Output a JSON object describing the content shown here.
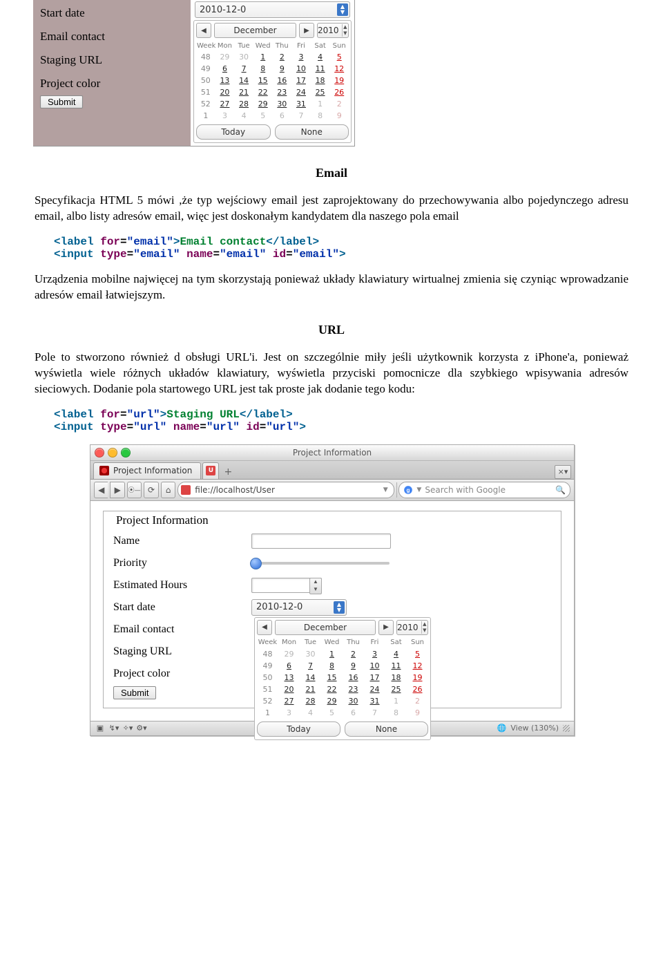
{
  "form": {
    "labels": {
      "start_date": "Start date",
      "email_contact": "Email contact",
      "staging_url": "Staging URL",
      "project_color": "Project color",
      "name": "Name",
      "priority": "Priority",
      "estimated_hours": "Estimated Hours"
    },
    "submit_label": "Submit",
    "date_value": "2010-12-0",
    "legend": "Project Information"
  },
  "calendar": {
    "month": "December",
    "year": "2010",
    "today_label": "Today",
    "none_label": "None",
    "head": [
      "Week",
      "Mon",
      "Tue",
      "Wed",
      "Thu",
      "Fri",
      "Sat",
      "Sun"
    ],
    "rows": [
      {
        "wk": "48",
        "d": [
          29,
          30,
          1,
          2,
          3,
          4,
          5
        ],
        "out": [
          0,
          1
        ],
        "sun": 6
      },
      {
        "wk": "49",
        "d": [
          6,
          7,
          8,
          9,
          10,
          11,
          12
        ],
        "out": [],
        "sun": 6
      },
      {
        "wk": "50",
        "d": [
          13,
          14,
          15,
          16,
          17,
          18,
          19
        ],
        "out": [],
        "sun": 6
      },
      {
        "wk": "51",
        "d": [
          20,
          21,
          22,
          23,
          24,
          25,
          26
        ],
        "out": [],
        "sun": 6
      },
      {
        "wk": "52",
        "d": [
          27,
          28,
          29,
          30,
          31,
          1,
          2
        ],
        "out": [
          5,
          6
        ],
        "sun": 6
      },
      {
        "wk": "1",
        "d": [
          3,
          4,
          5,
          6,
          7,
          8,
          9
        ],
        "out": [
          0,
          1,
          2,
          3,
          4,
          5,
          6
        ],
        "sun": 6
      }
    ]
  },
  "sections": {
    "email_title": "Email",
    "email_p": "Specyfikacja HTML 5 mówi ,że typ wejściowy email jest zaprojektowany do przechowywania albo pojedynczego adresu email, albo listy adresów email, więc jest doskonałym kandydatem dla naszego pola email",
    "email_code_line1_tag_open": "<label ",
    "email_code_line1_attr": "for=",
    "email_code_line1_val": "\"email\"",
    "email_code_line1_close": ">",
    "email_code_line1_text": "Email contact",
    "email_code_line1_end": "</label>",
    "email_code_line2": "<input type=\"email\" name=\"email\" id=\"email\">",
    "email_p2": "Urządzenia mobilne najwięcej na tym skorzystają ponieważ układy klawiatury wirtualnej zmienia się czyniąc wprowadzanie adresów email łatwiejszym.",
    "url_title": "URL",
    "url_p": "Pole to stworzono również d obsługi URL'i. Jest on szczególnie miły jeśli użytkownik korzysta z iPhone'a, ponieważ wyświetla wiele różnych układów klawiatury, wyświetla przyciski pomocnicze dla szybkiego wpisywania adresów sieciowych. Dodanie pola startowego URL jest tak proste jak dodanie tego kodu:",
    "url_code_line1_text": "Staging URL",
    "url_code_line2": "<input type=\"url\" name=\"url\" id=\"url\">"
  },
  "browser": {
    "window_title": "Project Information",
    "tab_label": "Project Information",
    "url": "file://localhost/User",
    "search_placeholder": "Search with Google",
    "status_right": "View (130%)"
  }
}
